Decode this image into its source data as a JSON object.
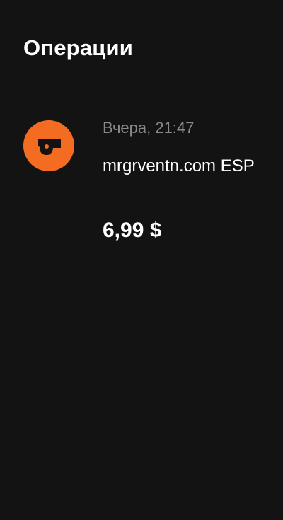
{
  "header": {
    "title": "Операции"
  },
  "operations": [
    {
      "icon": "whistle-icon",
      "icon_bg_color": "#f46c22",
      "time": "Вчера, 21:47",
      "merchant": "mrgrventn.com ESP",
      "amount": "6,99 $"
    }
  ]
}
